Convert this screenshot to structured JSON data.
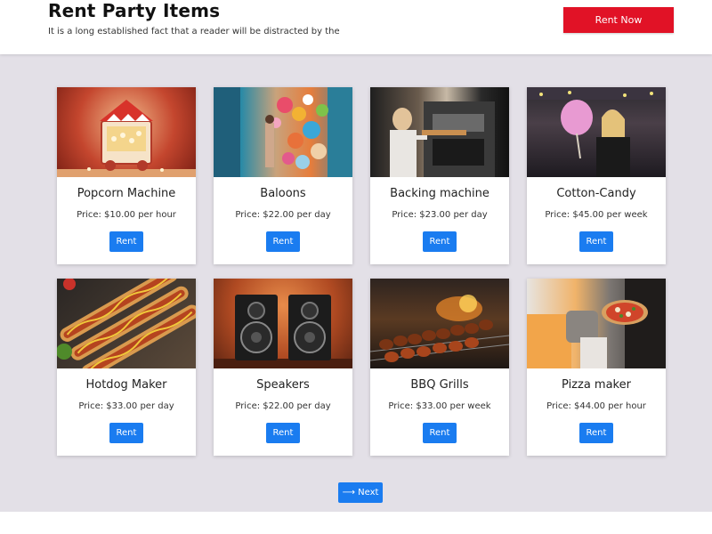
{
  "header": {
    "title": "Rent Party Items",
    "subtitle": "It is a long established fact that a reader will be distracted by the",
    "cta_label": "Rent Now"
  },
  "colors": {
    "accent_red": "#e11226",
    "button_blue": "#1a7cf0",
    "background_gray": "#e3e0e7"
  },
  "products": [
    {
      "name": "Popcorn Machine",
      "price": "Price: $10.00 per hour",
      "button": "Rent",
      "image": "popcorn-machine-image"
    },
    {
      "name": "Baloons",
      "price": "Price: $22.00 per day",
      "button": "Rent",
      "image": "balloons-image"
    },
    {
      "name": "Backing machine",
      "price": "Price: $23.00 per day",
      "button": "Rent",
      "image": "baking-oven-image"
    },
    {
      "name": "Cotton-Candy",
      "price": "Price: $45.00 per week",
      "button": "Rent",
      "image": "cotton-candy-image"
    },
    {
      "name": "Hotdog Maker",
      "price": "Price: $33.00 per day",
      "button": "Rent",
      "image": "hotdogs-image"
    },
    {
      "name": "Speakers",
      "price": "Price: $22.00 per day",
      "button": "Rent",
      "image": "speakers-image"
    },
    {
      "name": "BBQ Grills",
      "price": "Price: $33.00 per week",
      "button": "Rent",
      "image": "bbq-grill-image"
    },
    {
      "name": "Pizza maker",
      "price": "Price: $44.00 per hour",
      "button": "Rent",
      "image": "pizza-oven-image"
    }
  ],
  "pagination": {
    "next_label": "⟶ Next"
  }
}
